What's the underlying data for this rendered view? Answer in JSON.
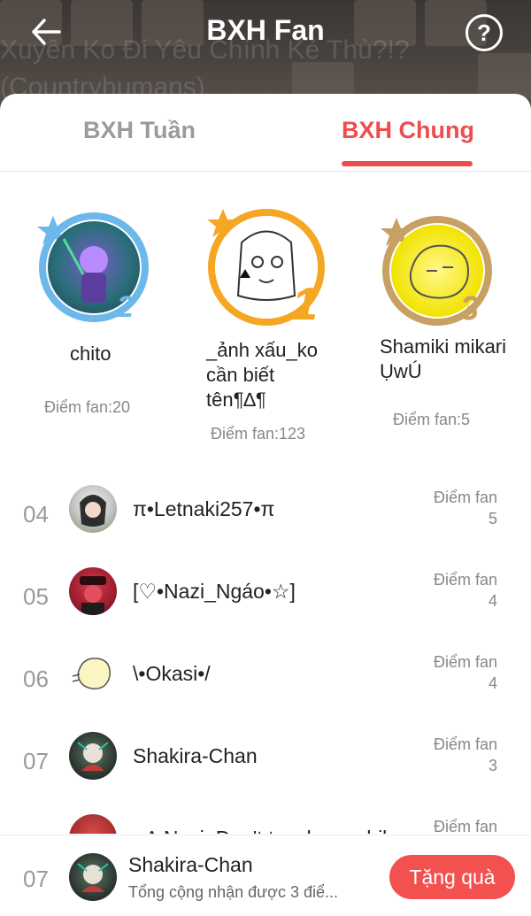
{
  "header": {
    "title": "BXH Fan",
    "background_text": "Xuyên Ko Đi Yêu Chính Kẻ Thù?!?\n(Countryhumans)",
    "back_icon": "arrow-left-icon",
    "help_icon": "question-circle-icon",
    "help_symbol": "?"
  },
  "tabs": [
    {
      "label": "BXH Tuần",
      "active": false
    },
    {
      "label": "BXH Chung",
      "active": true
    }
  ],
  "colors": {
    "accent": "#ef4d4d",
    "gold": "#f5a623",
    "silver": "#6cb8ea",
    "bronze": "#c9a063"
  },
  "podium": [
    {
      "rank_badge": "2",
      "name": "chito",
      "score": "Điểm fan:20"
    },
    {
      "rank_badge": "1",
      "name": "_ảnh xấu_ko cần biết tên¶∆¶",
      "score": "Điểm fan:123"
    },
    {
      "rank_badge": "3",
      "name": "Shamiki mikari ỤwÚ",
      "score": "Điểm fan:5"
    }
  ],
  "list": [
    {
      "rank": "04",
      "name": "π•Letnaki257•π",
      "score_label": "Điểm fan",
      "score": "5"
    },
    {
      "rank": "05",
      "name": "[♡•Nazi_Ngáo•☆]",
      "score_label": "Điểm fan",
      "score": "4"
    },
    {
      "rank": "06",
      "name": "\\•Okasi•/",
      "score_label": "Điểm fan",
      "score": "4"
    },
    {
      "rank": "07",
      "name": "Shakira-Chan",
      "score_label": "Điểm fan",
      "score": "3"
    },
    {
      "rank": "08",
      "name": "• ∆ Nazi_Don't touch my chil",
      "score_label": "Điểm fan",
      "score": ""
    }
  ],
  "my_rank": {
    "rank": "07",
    "name": "Shakira-Chan",
    "summary": "Tổng cộng nhận được 3 điể...",
    "gift_button": "Tặng quà"
  }
}
